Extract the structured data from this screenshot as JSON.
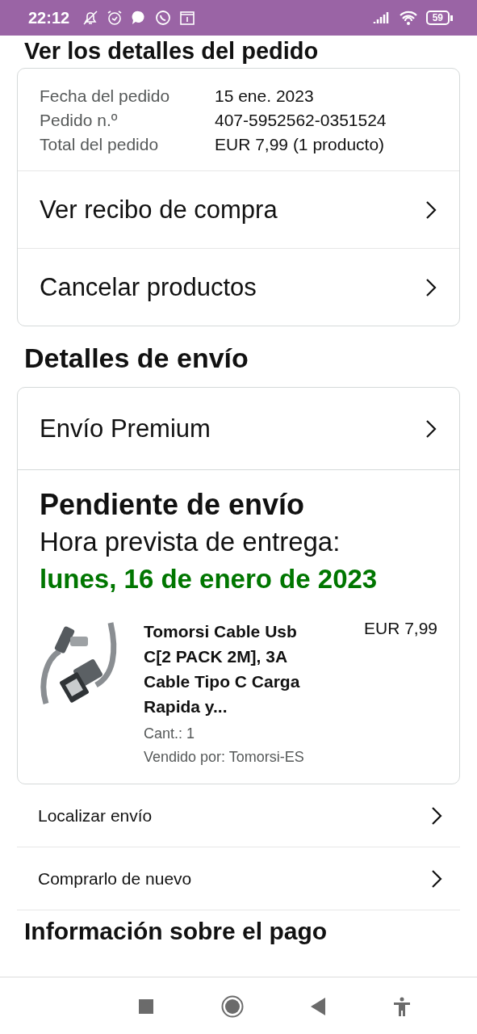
{
  "status_bar": {
    "time": "22:12",
    "battery": "59"
  },
  "top_heading": "Ver los detalles del pedido",
  "order_summary": [
    {
      "label": "Fecha del pedido",
      "value": "15 ene. 2023"
    },
    {
      "label": "Pedido n.º",
      "value": "407-5952562-0351524"
    },
    {
      "label": "Total del pedido",
      "value": "EUR 7,99 (1 producto)"
    }
  ],
  "order_actions": [
    "Ver recibo de compra",
    "Cancelar productos"
  ],
  "shipping_heading": "Detalles de envío",
  "shipping": {
    "method": "Envío Premium",
    "status": "Pendiente de envío",
    "delivery_label": "Hora prevista de entrega:",
    "delivery_date": "lunes, 16 de enero de 2023",
    "item": {
      "kind": "picture",
      "title": "Tomorsi Cable Usb C[2 PACK 2M], 3A Cable Tipo C Carga Rapida y...",
      "price": "EUR 7,99",
      "quantity": "Cant.: 1",
      "seller": "Vendido por: Tomorsi-ES"
    }
  },
  "shipping_actions": [
    "Localizar envío",
    "Comprarlo de nuevo"
  ],
  "payment_heading": "Información sobre el pago"
}
